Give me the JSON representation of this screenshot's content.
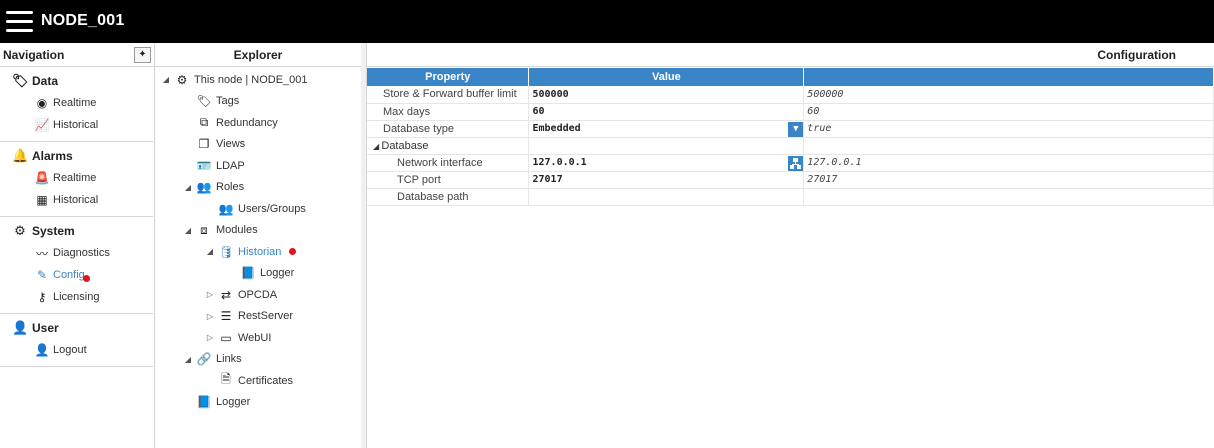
{
  "app": {
    "title": "NODE_001"
  },
  "navigation": {
    "header": "Navigation",
    "pin_icon": "pin-icon",
    "sections": [
      {
        "title": "Data",
        "icon": "tag-icon",
        "items": [
          {
            "label": "Realtime",
            "icon": "rss-icon"
          },
          {
            "label": "Historical",
            "icon": "line-chart-icon"
          }
        ]
      },
      {
        "title": "Alarms",
        "icon": "bell-icon",
        "items": [
          {
            "label": "Realtime",
            "icon": "alarm-light-icon"
          },
          {
            "label": "Historical",
            "icon": "table-icon"
          }
        ]
      },
      {
        "title": "System",
        "icon": "gear-icon",
        "items": [
          {
            "label": "Diagnostics",
            "icon": "pulse-icon"
          },
          {
            "label": "Config",
            "icon": "edit-icon",
            "active": true
          },
          {
            "label": "Licensing",
            "icon": "key-icon"
          }
        ]
      },
      {
        "title": "User",
        "icon": "user-icon",
        "items": [
          {
            "label": "Logout",
            "icon": "user-x-icon"
          }
        ]
      }
    ]
  },
  "explorer": {
    "header": "Explorer",
    "nodes": [
      {
        "label": "This node | NODE_001",
        "level": 0,
        "toggle": "expanded",
        "icon": "gears-icon"
      },
      {
        "label": "Tags",
        "level": 1,
        "toggle": "",
        "icon": "tag-icon"
      },
      {
        "label": "Redundancy",
        "level": 1,
        "toggle": "",
        "icon": "copy-icon"
      },
      {
        "label": "Views",
        "level": 1,
        "toggle": "",
        "icon": "windows-icon"
      },
      {
        "label": "LDAP",
        "level": 1,
        "toggle": "",
        "icon": "id-card-icon"
      },
      {
        "label": "Roles",
        "level": 1,
        "toggle": "expanded",
        "icon": "users-icon"
      },
      {
        "label": "Users/Groups",
        "level": 2,
        "toggle": "",
        "icon": "users-icon"
      },
      {
        "label": "Modules",
        "level": 1,
        "toggle": "expanded",
        "icon": "cubes-icon"
      },
      {
        "label": "Historian",
        "level": 2,
        "toggle": "expanded",
        "icon": "database-icon",
        "active": true
      },
      {
        "label": "Logger",
        "level": 3,
        "toggle": "",
        "icon": "book-icon"
      },
      {
        "label": "OPCDA",
        "level": 2,
        "toggle": "collapsed",
        "icon": "exchange-icon"
      },
      {
        "label": "RestServer",
        "level": 2,
        "toggle": "collapsed",
        "icon": "server-icon"
      },
      {
        "label": "WebUI",
        "level": 2,
        "toggle": "collapsed",
        "icon": "browser-window-icon"
      },
      {
        "label": "Links",
        "level": 1,
        "toggle": "expanded",
        "icon": "link-icon"
      },
      {
        "label": "Certificates",
        "level": 2,
        "toggle": "",
        "icon": "certificate-icon"
      },
      {
        "label": "Logger",
        "level": 1,
        "toggle": "",
        "icon": "book-icon"
      }
    ]
  },
  "configuration": {
    "header": "Configuration",
    "columns": {
      "property": "Property",
      "value": "Value",
      "default": ""
    },
    "rows": [
      {
        "property": "Store & Forward buffer limit",
        "value": "500000",
        "default": "500000"
      },
      {
        "property": "Max days",
        "value": "60",
        "default": "60"
      },
      {
        "property": "Database type",
        "value": "Embedded",
        "default": "true",
        "control": "dropdown"
      },
      {
        "group": "Database",
        "toggle": "expanded"
      },
      {
        "property": "Network interface",
        "value": "127.0.0.1",
        "default": "127.0.0.1",
        "child": true,
        "control": "network-picker"
      },
      {
        "property": "TCP port",
        "value": "27017",
        "default": "27017",
        "child": true
      },
      {
        "property": "Database path",
        "value": "",
        "default": "",
        "child": true
      }
    ]
  },
  "colors": {
    "accent": "#3a85c8",
    "topbar": "#000000",
    "alert_dot": "#e0141e"
  }
}
